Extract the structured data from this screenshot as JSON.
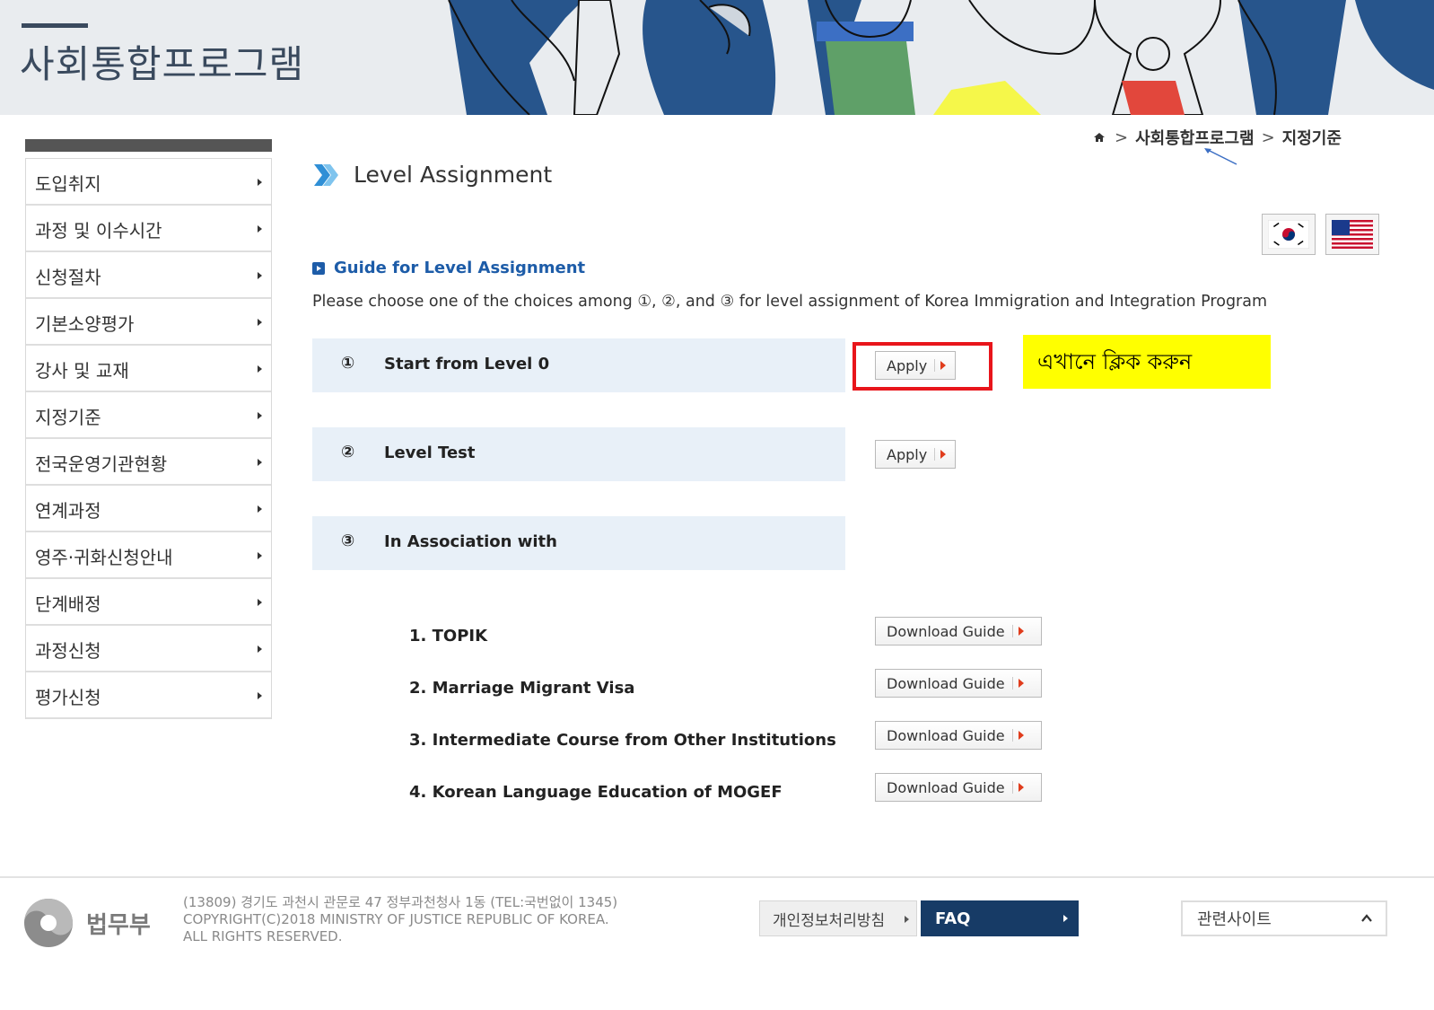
{
  "banner": {
    "title": "사회통합프로그램"
  },
  "sidebar": {
    "items": [
      {
        "label": "도입취지"
      },
      {
        "label": "과정 및 이수시간"
      },
      {
        "label": "신청절차"
      },
      {
        "label": "기본소양평가"
      },
      {
        "label": "강사 및 교재"
      },
      {
        "label": "지정기준"
      },
      {
        "label": "전국운영기관현황"
      },
      {
        "label": "연계과정"
      },
      {
        "label": "영주·귀화신청안내"
      },
      {
        "label": "단계배정"
      },
      {
        "label": "과정신청"
      },
      {
        "label": "평가신청"
      }
    ]
  },
  "breadcrumb": {
    "home_icon": "home-icon",
    "sep": ">",
    "level1": "사회통합프로그램",
    "level2": "지정기준"
  },
  "page": {
    "title": "Level Assignment"
  },
  "flags": {
    "korean": "korea-flag-icon",
    "english": "us-flag-icon"
  },
  "guide": {
    "heading": "Guide for Level Assignment",
    "description": "Please choose one of the choices among ①, ②, and ③ for level assignment of Korea Immigration and Integration Program"
  },
  "choices": [
    {
      "num": "①",
      "label": "Start from Level 0",
      "button": "Apply"
    },
    {
      "num": "②",
      "label": "Level Test",
      "button": "Apply"
    },
    {
      "num": "③",
      "label": "In Association with"
    }
  ],
  "associations": [
    {
      "label": "1. TOPIK",
      "button": "Download Guide"
    },
    {
      "label": "2. Marriage Migrant Visa",
      "button": "Download Guide"
    },
    {
      "label": "3. Intermediate Course from Other Institutions",
      "button": "Download Guide"
    },
    {
      "label": "4. Korean Language Education of MOGEF",
      "button": "Download Guide"
    }
  ],
  "annotation": {
    "note": "এখানে ক্লিক করুন",
    "highlight_color": "#ffff00",
    "box_color": "#e8151b"
  },
  "footer": {
    "logo_name": "법무부",
    "address": "(13809) 경기도 과천시 관문로 47 정부과천청사 1동 (TEL:국번없이 1345)",
    "copyright": "COPYRIGHT(C)2018 MINISTRY OF JUSTICE REPUBLIC OF KOREA.",
    "rights": "ALL RIGHTS RESERVED.",
    "privacy": "개인정보처리방침",
    "faq": "FAQ",
    "related": "관련사이트"
  },
  "colors": {
    "brand_dark": "#173b66",
    "accent_blue": "#1d5ca8",
    "choice_bg": "#e8f0f8"
  }
}
